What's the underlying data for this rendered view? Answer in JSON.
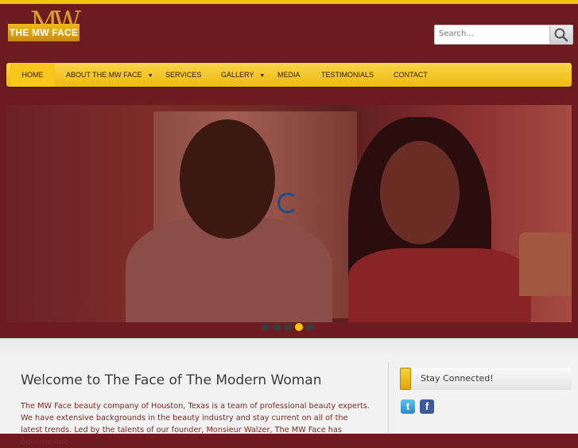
{
  "logo": {
    "text": "THE MW FACE",
    "monogram": "MW"
  },
  "search": {
    "placeholder": "Search...",
    "icon": "search-icon"
  },
  "nav": {
    "items": [
      {
        "label": "HOME",
        "active": true
      },
      {
        "label": "ABOUT THE MW FACE",
        "dropdown": true
      },
      {
        "label": "SERVICES"
      },
      {
        "label": "GALLERY",
        "dropdown": true
      },
      {
        "label": "MEDIA"
      },
      {
        "label": "TESTIMONIALS"
      },
      {
        "label": "CONTACT"
      }
    ]
  },
  "slider": {
    "slide_count": 5,
    "active_slide": 4
  },
  "welcome": {
    "title": "Welcome to The Face of The Modern Woman",
    "intro": "The MW Face beauty company of Houston, Texas is a team of professional beauty experts. We have extensive backgrounds in the beauty industry and stay current on all of the latest trends. Led by the talents of our founder, Monsieur Walzer, The MW Face has become one"
  },
  "sidebar": {
    "stay_connected": "Stay Connected!",
    "social": [
      {
        "name": "twitter-icon",
        "glyph": "t"
      },
      {
        "name": "facebook-icon",
        "glyph": "f"
      }
    ]
  },
  "colors": {
    "background": "#6d1b21",
    "accent": "#f2c500",
    "nav": "#efb90f"
  }
}
